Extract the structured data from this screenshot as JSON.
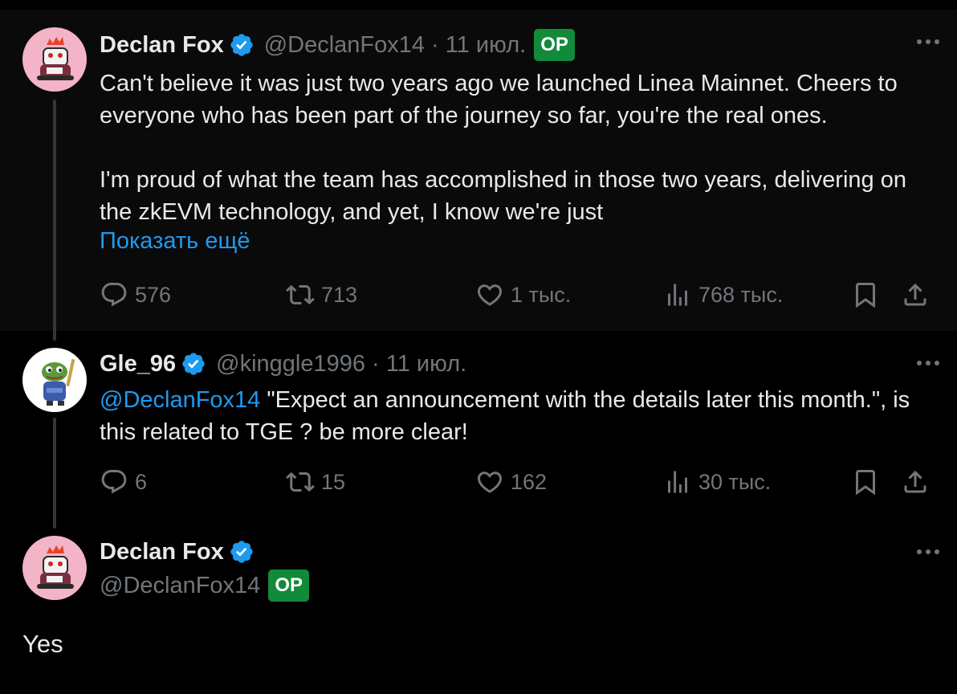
{
  "tweets": [
    {
      "name": "Declan Fox",
      "handle": "@DeclanFox14",
      "date": "· 11 июл.",
      "op": "OP",
      "text": [
        "Can't believe it was just two years ago we launched Linea Mainnet. Cheers to everyone who has been part of the journey so far, you're the real ones.",
        "I'm proud of what the team has accomplished in those two years, delivering on the zkEVM technology, and yet, I know we're just"
      ],
      "show_more": "Показать ещё",
      "stats": {
        "replies": "576",
        "reposts": "713",
        "likes": "1 тыс.",
        "views": "768 тыс."
      }
    },
    {
      "name": "Gle_96",
      "handle": "@kinggle1996",
      "date": "· 11 июл.",
      "mention": "@DeclanFox14",
      "text": " \"Expect an announcement with the details later this month.\", is this related to TGE ? be more clear!",
      "stats": {
        "replies": "6",
        "reposts": "15",
        "likes": "162",
        "views": "30 тыс."
      }
    },
    {
      "name": "Declan Fox",
      "handle": "@DeclanFox14",
      "op": "OP",
      "text": "Yes"
    }
  ],
  "colors": {
    "accent": "#1d9bf0",
    "op_badge": "#118a3a",
    "muted": "#71767b",
    "background": "#000000"
  },
  "icons": [
    "verified-icon",
    "reply-icon",
    "repost-icon",
    "like-icon",
    "views-icon",
    "bookmark-icon",
    "share-icon",
    "more-icon"
  ]
}
